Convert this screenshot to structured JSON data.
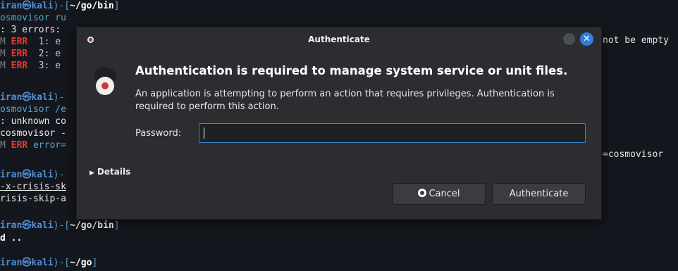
{
  "terminal": {
    "lines": [
      {
        "user": "iran",
        "at": "㉿",
        "host": "kali",
        "sep": ")-[",
        "path": "~/go/bin",
        "close": "]"
      },
      {
        "cmd": "osmovisor ru"
      },
      {
        "text": ": 3 errors:"
      },
      {
        "level": "ERR",
        "text": "  1: e"
      },
      {
        "level": "ERR",
        "text": "  2: e"
      },
      {
        "level": "ERR",
        "text": "  3: e"
      },
      {
        "user": "iran",
        "at": "㉿",
        "host": "kali",
        "sep": ")-"
      },
      {
        "cmd": "osmovisor /e"
      },
      {
        "text": ": unknown co"
      },
      {
        "text": "cosmovisor -"
      },
      {
        "level": "ERR",
        "text": " error="
      },
      {
        "user": "iran",
        "at": "㉿",
        "host": "kali",
        "sep": ")-"
      },
      {
        "text": "-x-crisis-sk"
      },
      {
        "text": "risis-skip-a"
      },
      {
        "user": "iran",
        "at": "㉿",
        "host": "kali",
        "sep": ")-[",
        "path": "~/go/bin",
        "close": "]"
      },
      {
        "text": "d .."
      },
      {
        "user": "iran",
        "at": "㉿",
        "host": "kali",
        "sep": ")-[",
        "path": "~/go",
        "close": "]"
      }
    ],
    "right_texts": {
      "not_empty": "not be empty",
      "cosmovisor": "=cosmovisor"
    }
  },
  "dialog": {
    "title": "Authenticate",
    "close_glyph": "✕",
    "heading": "Authentication is required to manage system service or unit files.",
    "description": "An application is attempting to perform an action that requires privileges. Authentication is required to perform this action.",
    "password_label": "Password:",
    "password_value": "",
    "details_label": "Details",
    "details_arrow": "▶",
    "cancel_label": "Cancel",
    "authenticate_label": "Authenticate"
  }
}
